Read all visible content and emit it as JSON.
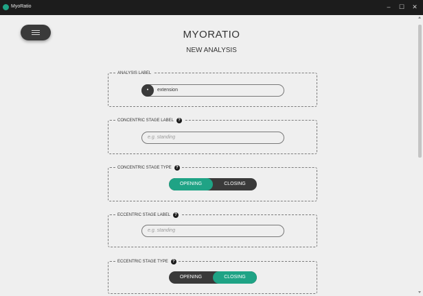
{
  "window": {
    "title": "MyoRatio",
    "minimize": "–",
    "maximize": "☐",
    "close": "✕"
  },
  "header": {
    "app_name": "MYORATIO",
    "subtitle": "NEW ANALYSIS"
  },
  "sections": [
    {
      "legend": "ANALYSIS LABEL",
      "kind": "input",
      "value": "extension",
      "badge": "•"
    },
    {
      "legend": "CONCENTRIC STAGE LABEL",
      "kind": "input",
      "placeholder": "e.g. standing",
      "help": "?"
    },
    {
      "legend": "CONCENTRIC STAGE TYPE",
      "kind": "toggle",
      "options": [
        "OPENING",
        "CLOSING"
      ],
      "selected": "OPENING",
      "help": "?"
    },
    {
      "legend": "ECCENTRIC STAGE LABEL",
      "kind": "input",
      "placeholder": "e.g. standing",
      "help": "?"
    },
    {
      "legend": "ECCENTRIC STAGE TYPE",
      "kind": "toggle",
      "options": [
        "OPENING",
        "CLOSING"
      ],
      "selected": "CLOSING",
      "help": "?"
    }
  ],
  "colors": {
    "accent": "#1fa385",
    "dark": "#3a3a3a",
    "background": "#efefef",
    "titlebar": "#1c1c1c"
  },
  "icons": {
    "menu": "hamburger-icon",
    "help": "question-circle-icon"
  }
}
